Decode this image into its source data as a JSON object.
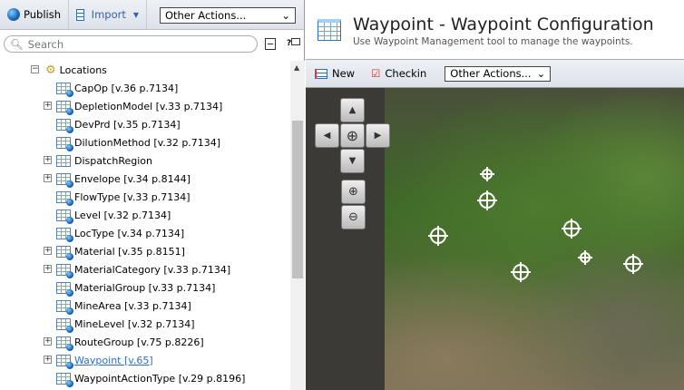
{
  "toolbar": {
    "publish": "Publish",
    "import": "Import",
    "other_actions": "Other Actions..."
  },
  "search": {
    "placeholder": "Search"
  },
  "tree": {
    "root": "Locations",
    "items": [
      {
        "label": "CapOp [v.36 p.7134]",
        "exp": false
      },
      {
        "label": "DepletionModel [v.33 p.7134]",
        "exp": true
      },
      {
        "label": "DevPrd [v.35 p.7134]",
        "exp": false
      },
      {
        "label": "DilutionMethod [v.32 p.7134]",
        "exp": false
      },
      {
        "label": "DispatchRegion",
        "exp": true,
        "plain": true
      },
      {
        "label": "Envelope [v.34 p.8144]",
        "exp": true
      },
      {
        "label": "FlowType [v.33 p.7134]",
        "exp": false
      },
      {
        "label": "Level [v.32 p.7134]",
        "exp": false
      },
      {
        "label": "LocType [v.34 p.7134]",
        "exp": false
      },
      {
        "label": "Material [v.35 p.8151]",
        "exp": true
      },
      {
        "label": "MaterialCategory [v.33 p.7134]",
        "exp": true
      },
      {
        "label": "MaterialGroup [v.33 p.7134]",
        "exp": false
      },
      {
        "label": "MineArea [v.33 p.7134]",
        "exp": false
      },
      {
        "label": "MineLevel [v.32 p.7134]",
        "exp": false
      },
      {
        "label": "RouteGroup [v.75 p.8226]",
        "exp": true
      },
      {
        "label": "Waypoint [v.65]",
        "exp": true,
        "link": true
      },
      {
        "label": "WaypointActionType [v.29 p.8196]",
        "exp": false
      }
    ]
  },
  "page": {
    "title": "Waypoint - Waypoint Configuration",
    "subtitle": "Use Waypoint Management tool to manage the waypoints."
  },
  "actions": {
    "new": "New",
    "checkin": "Checkin",
    "other_actions": "Other Actions..."
  }
}
